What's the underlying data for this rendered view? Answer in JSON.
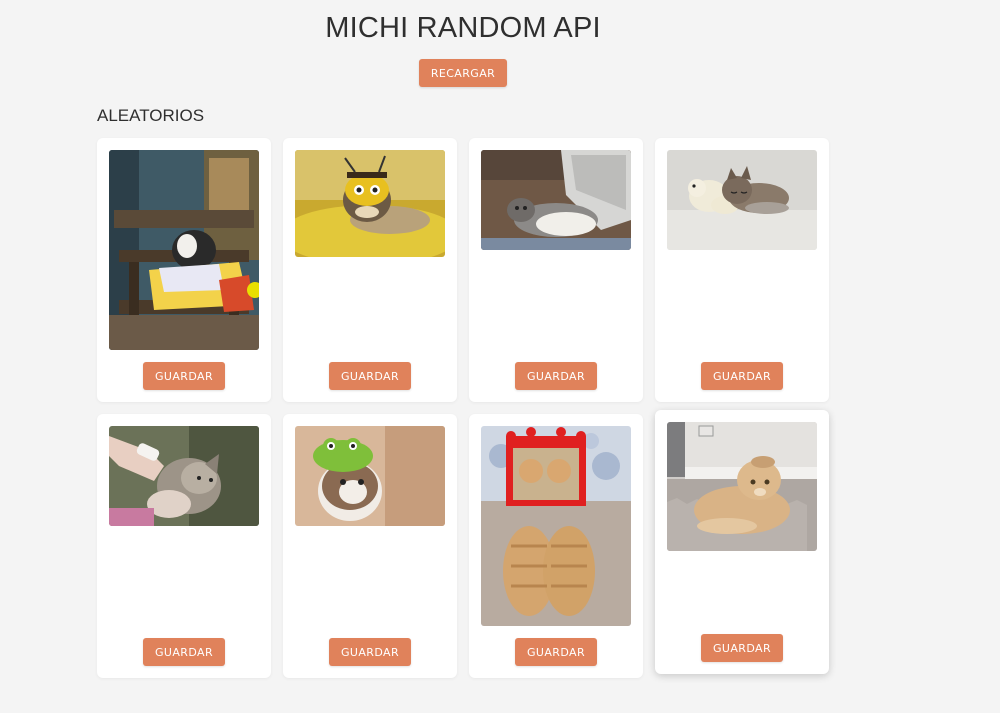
{
  "header": {
    "title": "MICHI RANDOM API",
    "reload_label": "RECARGAR"
  },
  "section": {
    "title": "ALEATORIOS"
  },
  "cards": [
    {
      "save_label": "GUARDAR",
      "image": "cat-reading-book-on-bench"
    },
    {
      "save_label": "GUARDAR",
      "image": "cat-with-bee-hat"
    },
    {
      "save_label": "GUARDAR",
      "image": "cat-lying-on-back-by-laptop"
    },
    {
      "save_label": "GUARDAR",
      "image": "kitten-with-plush-toy"
    },
    {
      "save_label": "GUARDAR",
      "image": "kitten-drinking-from-bottle"
    },
    {
      "save_label": "GUARDAR",
      "image": "cat-with-frog-hat"
    },
    {
      "save_label": "GUARDAR",
      "image": "cats-in-front-of-mirror"
    },
    {
      "save_label": "GUARDAR",
      "image": "scottish-fold-on-rug"
    }
  ],
  "colors": {
    "accent": "#e0825b",
    "background": "#f4f4f4",
    "card": "#ffffff"
  }
}
